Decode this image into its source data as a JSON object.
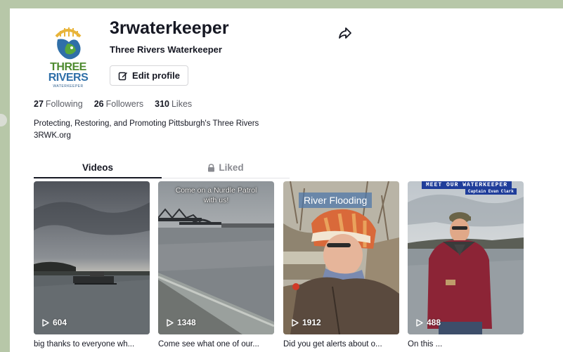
{
  "profile": {
    "username": "3rwaterkeeper",
    "display_name": "Three Rivers Waterkeeper",
    "logo_text_line1": "THREE",
    "logo_text_line2": "RIVERS",
    "logo_sub": "WATERKEEPER",
    "edit_label": "Edit profile",
    "bio_line1": "Protecting, Restoring, and Promoting Pittsburgh's Three Rivers",
    "bio_line2": "3RWK.org"
  },
  "stats": {
    "following_count": "27",
    "following_label": "Following",
    "followers_count": "26",
    "followers_label": "Followers",
    "likes_count": "310",
    "likes_label": "Likes"
  },
  "tabs": {
    "videos": "Videos",
    "liked": "Liked"
  },
  "videos": [
    {
      "views": "604",
      "caption": "big thanks to everyone wh..."
    },
    {
      "views": "1348",
      "caption": "Come see what one of our...",
      "overlay": "Come on a Nurdle Patrol with us!"
    },
    {
      "views": "1912",
      "caption": "Did you get alerts about o...",
      "overlay": "River Flooding"
    },
    {
      "views": "488",
      "caption": "On this ...",
      "overlay": "MEET OUR WATERKEEPER",
      "overlay_sub": "Captain Evan Clark"
    }
  ],
  "icons": {
    "share": "share-arrow-icon",
    "edit": "edit-icon",
    "lock": "lock-icon",
    "play": "play-icon"
  }
}
